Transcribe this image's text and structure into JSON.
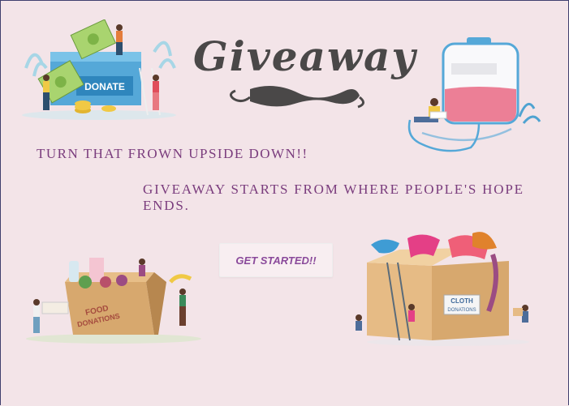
{
  "title": "Giveaway",
  "tagline": "TURN THAT FROWN UPSIDE DOWN!!",
  "subtitle": "GIVEAWAY STARTS FROM WHERE PEOPLE'S HOPE ENDS.",
  "cta_label": "GET STARTED!!",
  "illustrations": {
    "donate_box_label": "DONATE",
    "food_box_label_1": "FOOD",
    "food_box_label_2": "DONATIONS",
    "cloth_box_label_1": "CLOTH",
    "cloth_box_label_2": "DONATIONS"
  },
  "colors": {
    "background": "#f3e4e8",
    "text_accent": "#7a3c7d",
    "button_text": "#8a4a9b",
    "title_color": "#4a4848"
  }
}
